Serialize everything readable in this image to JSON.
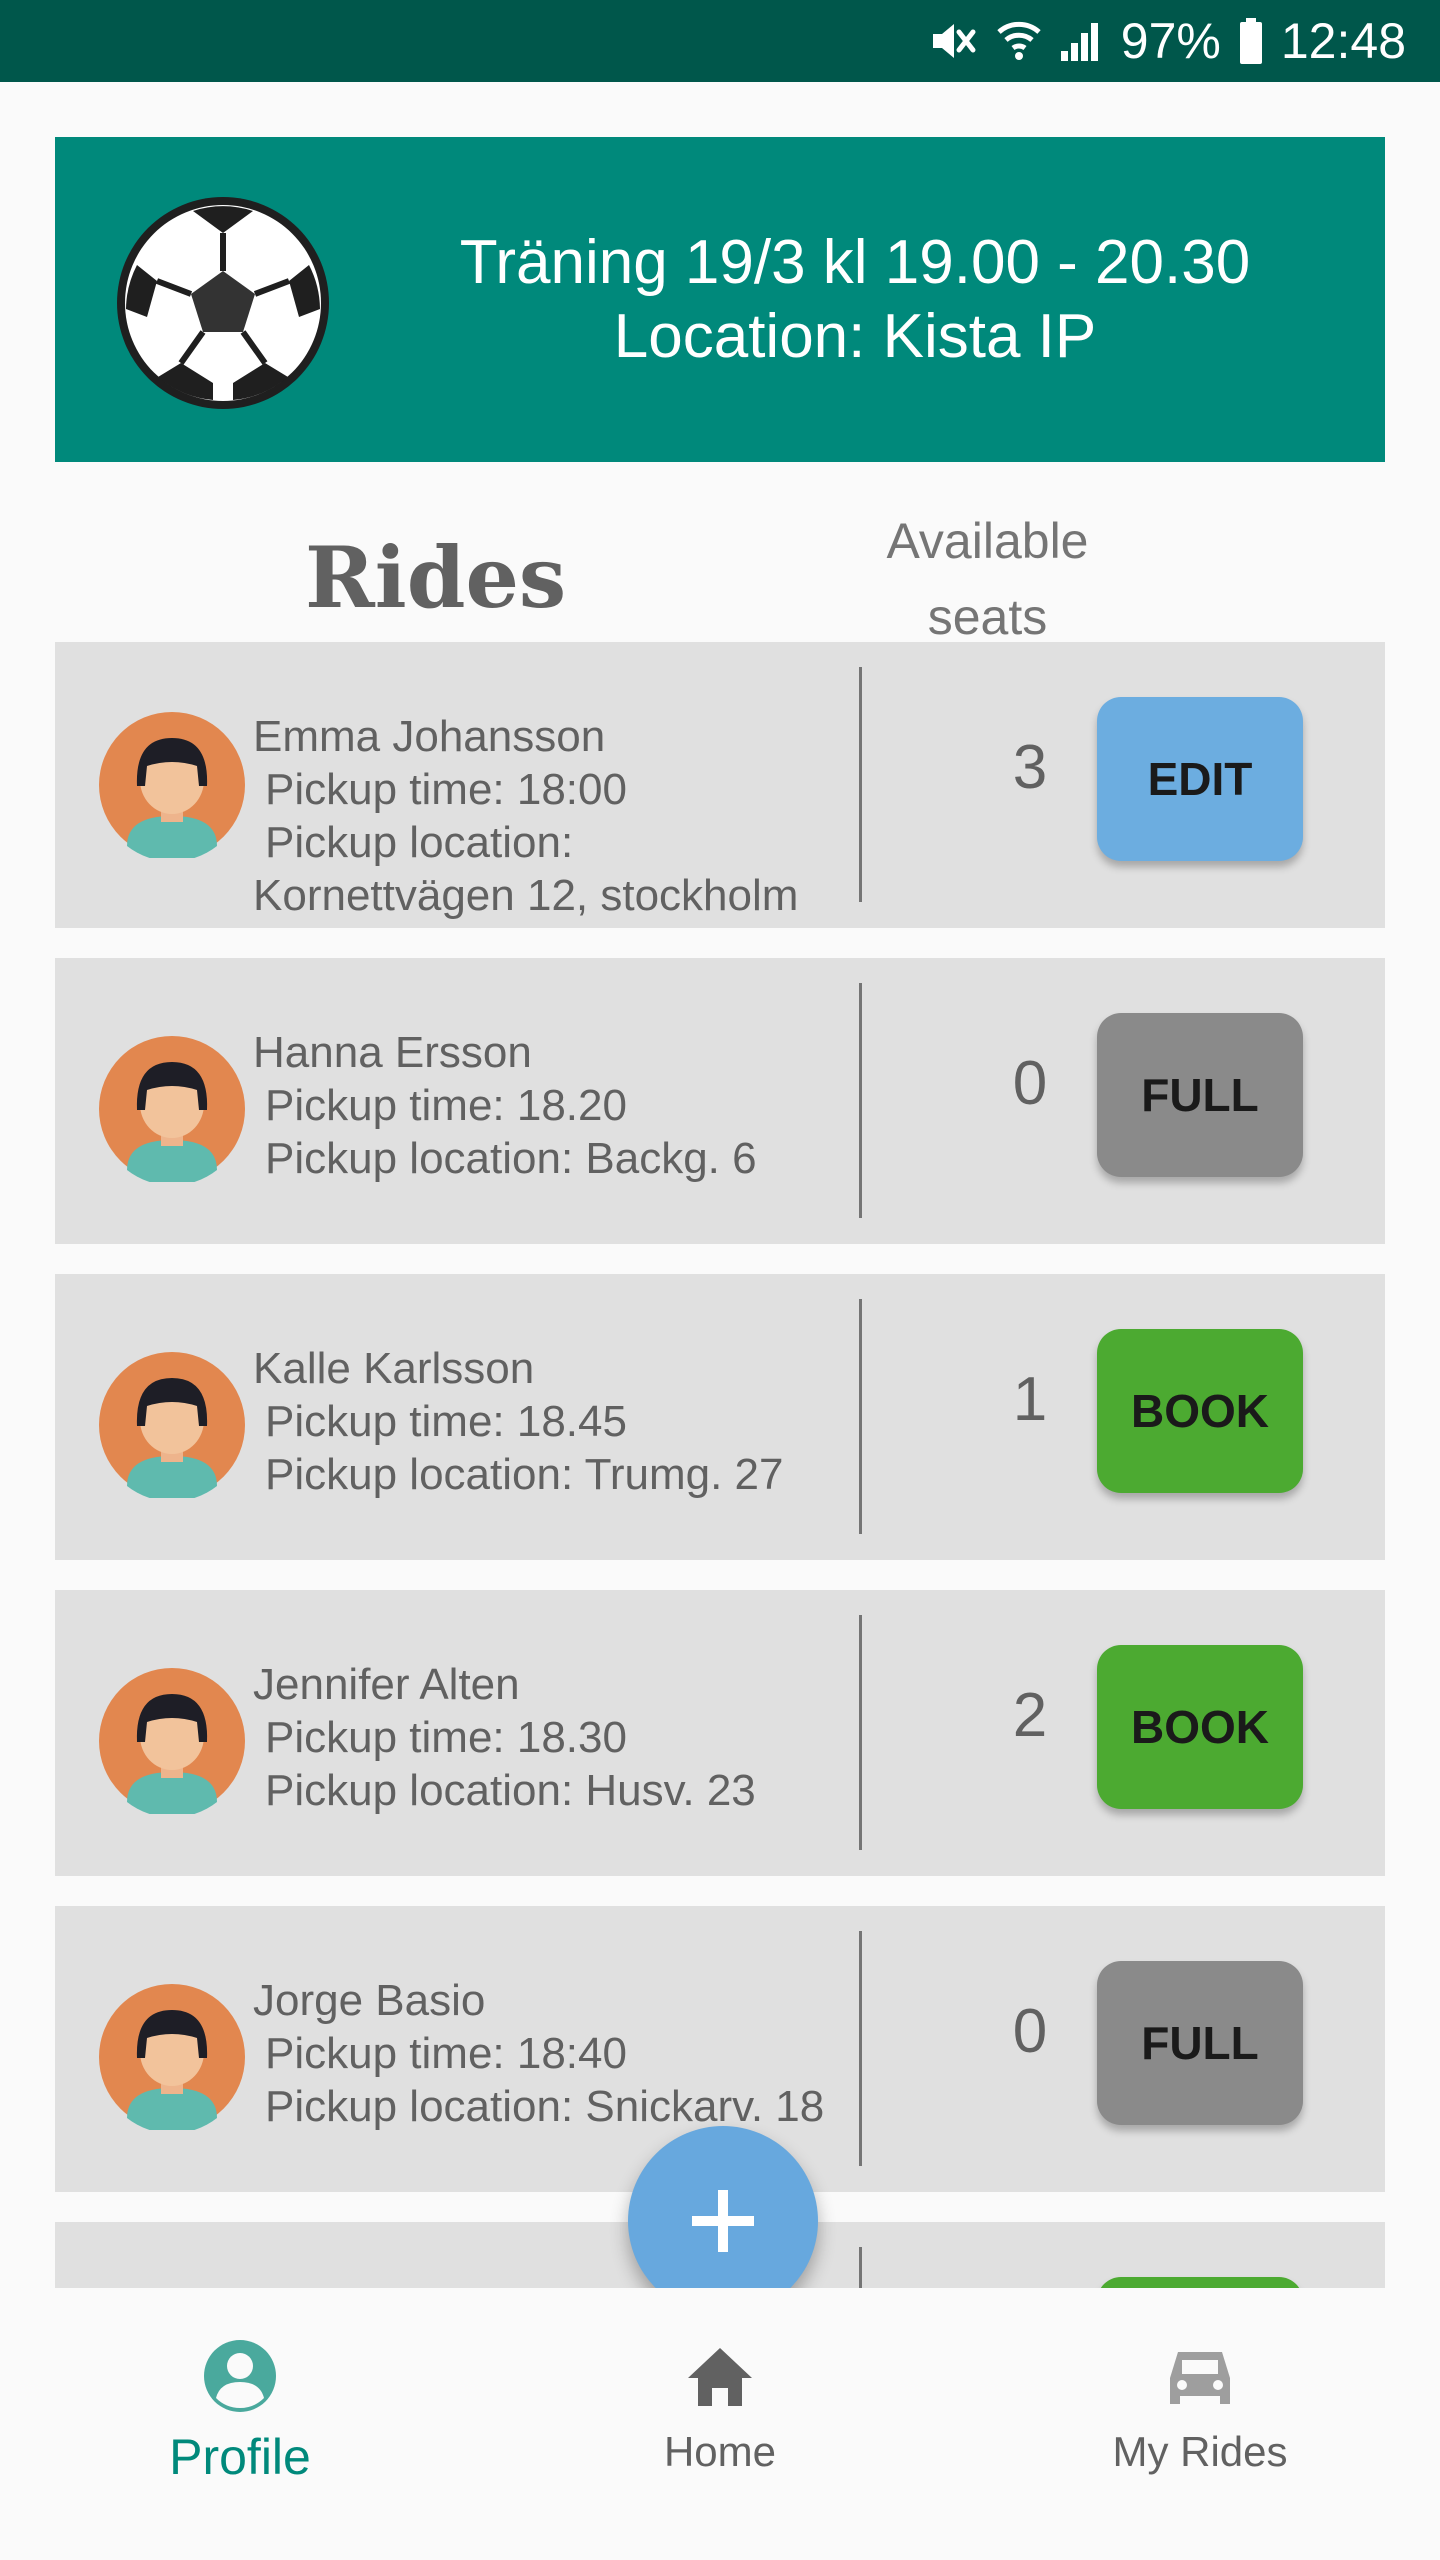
{
  "status_bar": {
    "battery": "97%",
    "time": "12:48",
    "icons": [
      "mute-icon",
      "wifi-icon",
      "signal-icon",
      "battery-icon"
    ]
  },
  "event": {
    "title": "Träning 19/3 kl 19.00 - 20.30",
    "location": "Location: Kista IP",
    "icon": "soccer-ball-icon"
  },
  "columns": {
    "rides": "Rides",
    "seats_line1": "Available",
    "seats_line2": "seats"
  },
  "rides": [
    {
      "name": "Emma Johansson",
      "pickup_time": "Pickup time: 18:00",
      "pickup_location": "Pickup location:",
      "pickup_location_2": "Kornettvägen 12, stockholm",
      "seats": "3",
      "action": "EDIT",
      "action_color": "#6cade0"
    },
    {
      "name": "Hanna Ersson",
      "pickup_time": "Pickup time: 18.20",
      "pickup_location": "Pickup location: Backg. 6",
      "seats": "0",
      "action": "FULL",
      "action_color": "#8a8a8a"
    },
    {
      "name": "Kalle Karlsson",
      "pickup_time": "Pickup time: 18.45",
      "pickup_location": "Pickup location: Trumg. 27",
      "seats": "1",
      "action": "BOOK",
      "action_color": "#4caa31"
    },
    {
      "name": "Jennifer Alten",
      "pickup_time": "Pickup time: 18.30",
      "pickup_location": "Pickup location: Husv. 23",
      "seats": "2",
      "action": "BOOK",
      "action_color": "#4caa31"
    },
    {
      "name": "Jorge Basio",
      "pickup_time": "Pickup time: 18:40",
      "pickup_location": "Pickup location: Snickarv. 18",
      "seats": "0",
      "action": "FULL",
      "action_color": "#8a8a8a"
    }
  ],
  "fab": {
    "icon": "plus-icon"
  },
  "nav": {
    "profile": "Profile",
    "home": "Home",
    "my_rides": "My Rides",
    "active": "profile"
  },
  "colors": {
    "status_bar": "#00574b",
    "primary": "#00897b",
    "card": "#e0e0e0",
    "fab": "#67a8de"
  }
}
